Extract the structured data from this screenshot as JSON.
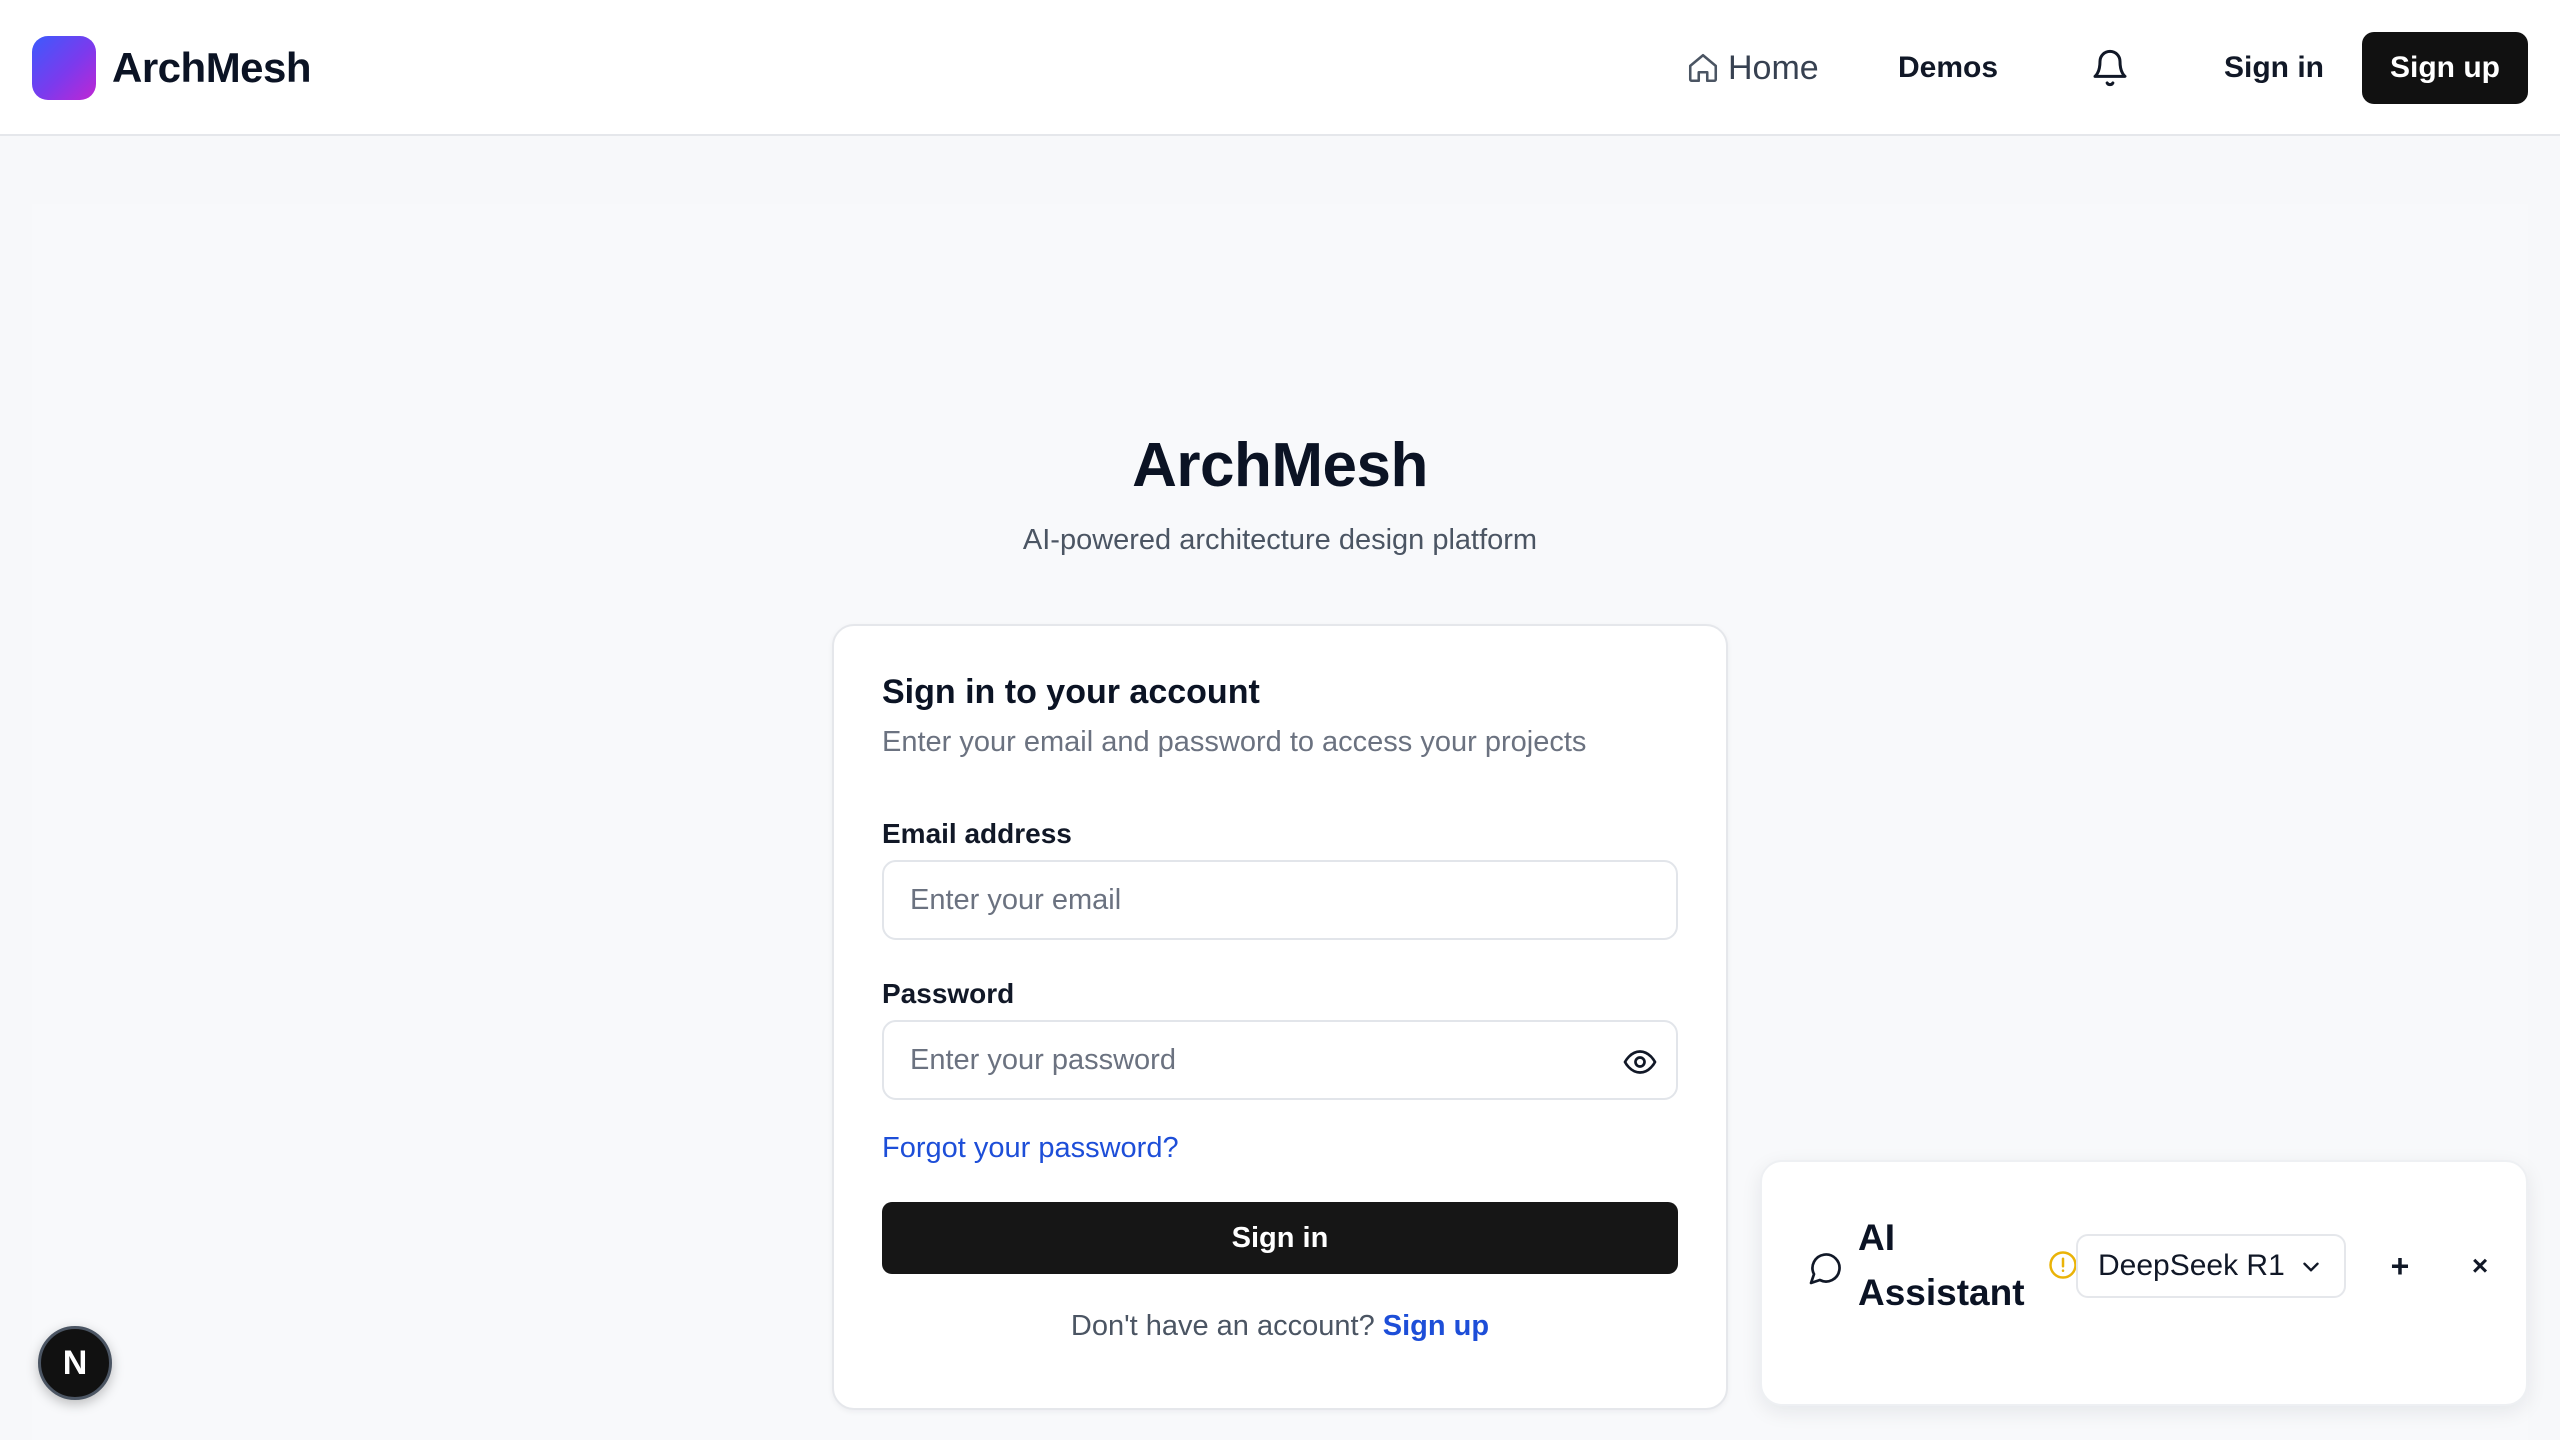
{
  "header": {
    "logo_text": "ArchMesh",
    "nav": {
      "home_label": "Home",
      "demos_label": "Demos",
      "signin_label": "Sign in",
      "signup_label": "Sign up"
    }
  },
  "hero": {
    "title": "ArchMesh",
    "subtitle": "AI-powered architecture design platform"
  },
  "signin_card": {
    "title": "Sign in to your account",
    "description": "Enter your email and password to access your projects",
    "email": {
      "label": "Email address",
      "placeholder": "Enter your email",
      "value": ""
    },
    "password": {
      "label": "Password",
      "placeholder": "Enter your password",
      "value": ""
    },
    "forgot_label": "Forgot your password?",
    "submit_label": "Sign in",
    "no_account_text": "Don't have an account?",
    "signup_link": "Sign up"
  },
  "ai_assistant": {
    "title": "AI Assistant",
    "model": "DeepSeek R1",
    "add_label": "+",
    "close_label": "×"
  },
  "badge": {
    "letter": "N"
  },
  "colors": {
    "brand_gradient_start": "#3b5bfd",
    "brand_gradient_end": "#c026d3",
    "primary_button": "#111111",
    "link": "#1d4ed8",
    "warning": "#eab308"
  },
  "icons": [
    "home-icon",
    "bell-icon",
    "eye-icon",
    "chat-bubble-icon",
    "warning-icon",
    "chevron-down-icon"
  ]
}
